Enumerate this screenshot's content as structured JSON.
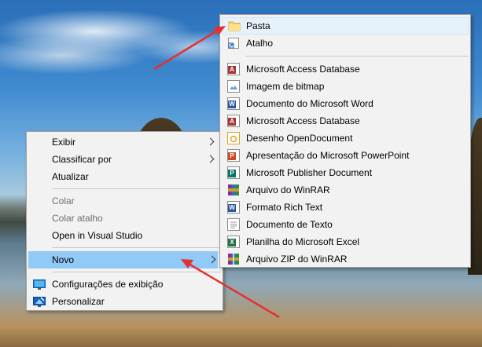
{
  "context_menu": {
    "items": [
      {
        "label": "Exibir",
        "submenu": true
      },
      {
        "label": "Classificar por",
        "submenu": true
      },
      {
        "label": "Atualizar"
      },
      {
        "label": "Colar",
        "disabled": true
      },
      {
        "label": "Colar atalho",
        "disabled": true
      },
      {
        "label": "Open in Visual Studio"
      },
      {
        "label": "Novo",
        "submenu": true,
        "active": true
      },
      {
        "label": "Configurações de exibição",
        "icon": "display-settings-icon"
      },
      {
        "label": "Personalizar",
        "icon": "personalize-icon"
      }
    ]
  },
  "new_submenu": {
    "items": [
      {
        "label": "Pasta",
        "icon": "folder-icon",
        "active": true
      },
      {
        "label": "Atalho",
        "icon": "shortcut-icon"
      },
      {
        "label": "Microsoft Access Database",
        "icon": "access-icon"
      },
      {
        "label": "Imagem de bitmap",
        "icon": "bitmap-icon"
      },
      {
        "label": "Documento do Microsoft Word",
        "icon": "word-icon"
      },
      {
        "label": "Microsoft Access Database",
        "icon": "access-icon"
      },
      {
        "label": "Desenho OpenDocument",
        "icon": "opendocument-drawing-icon"
      },
      {
        "label": "Apresentação do Microsoft PowerPoint",
        "icon": "powerpoint-icon"
      },
      {
        "label": "Microsoft Publisher Document",
        "icon": "publisher-icon"
      },
      {
        "label": "Arquivo do WinRAR",
        "icon": "winrar-icon"
      },
      {
        "label": "Formato Rich Text",
        "icon": "rtf-icon"
      },
      {
        "label": "Documento de Texto",
        "icon": "text-document-icon"
      },
      {
        "label": "Planilha do Microsoft Excel",
        "icon": "excel-icon"
      },
      {
        "label": "Arquivo ZIP do WinRAR",
        "icon": "winrar-zip-icon"
      }
    ]
  },
  "colors": {
    "annotation_arrow": "#e53030",
    "menu_background": "#f2f2f2",
    "highlight": "#91c9f7"
  }
}
